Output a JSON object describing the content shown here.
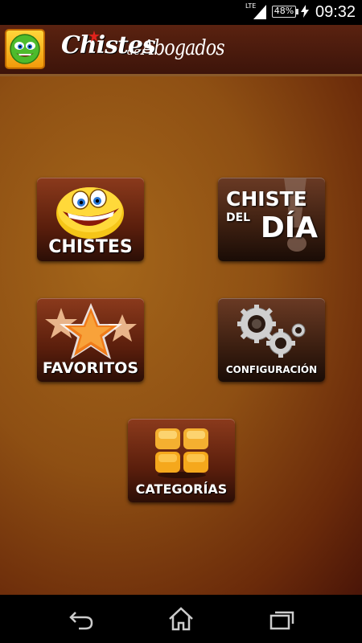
{
  "status_bar": {
    "network": "LTE",
    "battery": "48%",
    "time": "09:32"
  },
  "header": {
    "title_main": "Chistes",
    "title_de": "de",
    "title_sub": "Abogados"
  },
  "menu": {
    "chistes": "CHISTES",
    "chiste_del_dia_line1": "CHISTE",
    "chiste_del_dia_line2": "DEL",
    "chiste_del_dia_line3": "DÍA",
    "favoritos": "FAVORITOS",
    "configuracion": "CONFIGURACIÓN",
    "categorias": "CATEGORÍAS"
  },
  "nav": {
    "back_icon": "back-icon",
    "home_icon": "home-icon",
    "recents_icon": "recents-icon"
  }
}
